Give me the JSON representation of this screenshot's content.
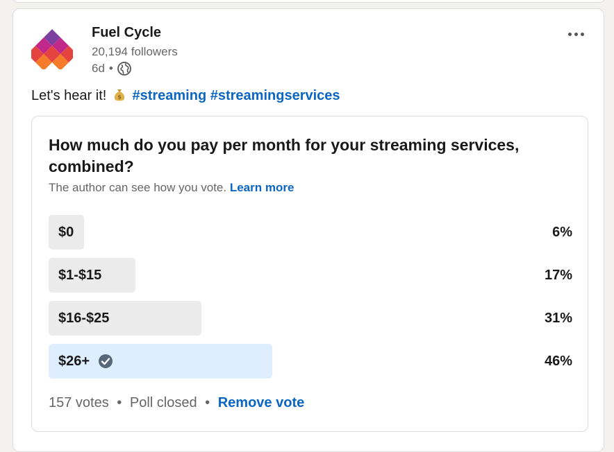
{
  "post": {
    "author": {
      "name": "Fuel Cycle",
      "followers": "20,194 followers",
      "time": "6d",
      "meta_separator": "•",
      "visibility_icon": "globe-icon",
      "logo_colors": [
        "#7b3fa0",
        "#c2278a",
        "#e4433f",
        "#f47b2a"
      ]
    },
    "more_menu_icon": "ellipsis-icon",
    "text": {
      "lead": "Let's hear it!",
      "emoji_icon": "money-bag-icon",
      "hashtags": [
        "#streaming",
        "#streamingservices"
      ]
    }
  },
  "poll": {
    "question": "How much do you pay per month for your streaming services, combined?",
    "visibility_note": "The author can see how you vote.",
    "learn_more": "Learn more",
    "options": [
      {
        "label": "$0",
        "percent_text": "6%",
        "percent": 6,
        "selected": false
      },
      {
        "label": "$1-$15",
        "percent_text": "17%",
        "percent": 17,
        "selected": false
      },
      {
        "label": "$16-$25",
        "percent_text": "31%",
        "percent": 31,
        "selected": false
      },
      {
        "label": "$26+",
        "percent_text": "46%",
        "percent": 46,
        "selected": true
      }
    ],
    "footer": {
      "votes": "157 votes",
      "separator": "•",
      "status": "Poll closed",
      "remove_vote": "Remove vote"
    }
  },
  "colors": {
    "link": "#0a66c2",
    "bar_default": "#ebebeb",
    "bar_selected": "#dfeefe",
    "check": "#56687a"
  }
}
